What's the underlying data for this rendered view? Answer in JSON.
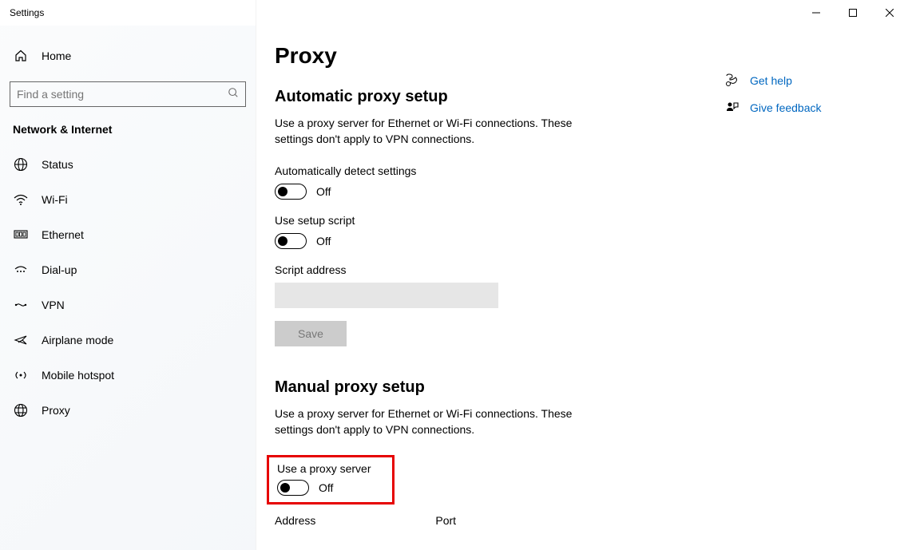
{
  "window": {
    "title": "Settings"
  },
  "sidebar": {
    "home": "Home",
    "search_placeholder": "Find a setting",
    "section": "Network & Internet",
    "items": [
      {
        "label": "Status",
        "icon": "status"
      },
      {
        "label": "Wi-Fi",
        "icon": "wifi"
      },
      {
        "label": "Ethernet",
        "icon": "ethernet"
      },
      {
        "label": "Dial-up",
        "icon": "dialup"
      },
      {
        "label": "VPN",
        "icon": "vpn"
      },
      {
        "label": "Airplane mode",
        "icon": "airplane"
      },
      {
        "label": "Mobile hotspot",
        "icon": "hotspot"
      },
      {
        "label": "Proxy",
        "icon": "proxy"
      }
    ]
  },
  "main": {
    "title": "Proxy",
    "auto": {
      "heading": "Automatic proxy setup",
      "desc": "Use a proxy server for Ethernet or Wi-Fi connections. These settings don't apply to VPN connections.",
      "detect_label": "Automatically detect settings",
      "detect_state": "Off",
      "script_label": "Use setup script",
      "script_state": "Off",
      "script_addr_label": "Script address",
      "script_addr_value": "",
      "save_label": "Save"
    },
    "manual": {
      "heading": "Manual proxy setup",
      "desc": "Use a proxy server for Ethernet or Wi-Fi connections. These settings don't apply to VPN connections.",
      "use_label": "Use a proxy server",
      "use_state": "Off",
      "address_label": "Address",
      "port_label": "Port"
    }
  },
  "aside": {
    "help": "Get help",
    "feedback": "Give feedback"
  }
}
